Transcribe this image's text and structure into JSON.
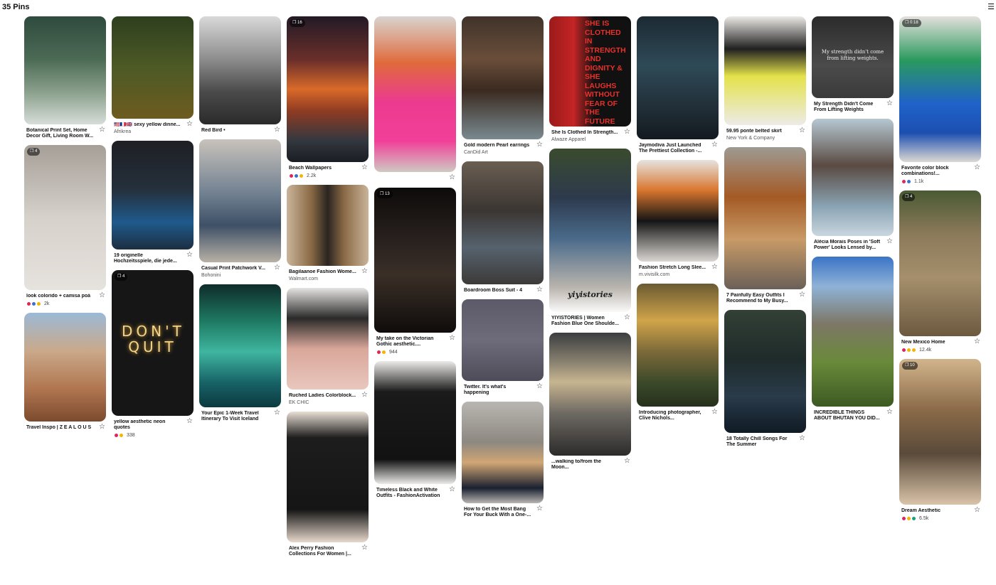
{
  "board": {
    "pin_count_label": "35 Pins"
  },
  "columns": [
    [
      {
        "title": "Botanical Print Set, Home Decor Gift, Living Room W...",
        "source": "",
        "reactions": [],
        "count": "",
        "badge": "",
        "h": 152,
        "bg": "linear-gradient(180deg,#2f4a3e 0%,#4c6b55 40%,#8aa08c 70%,#d7ddd9 100%)"
      },
      {
        "title": "look colorido + camisa poá",
        "source": "",
        "reactions": [
          "#e0245e",
          "#3b6fd8",
          "#f4b400"
        ],
        "count": "2k",
        "badge": "4",
        "h": 204,
        "bg": "linear-gradient(180deg,#a69f98 0%,#d6d1cb 50%,#e6e2dd 100%)"
      },
      {
        "title": "Travel Inspo | Z E A L O U S",
        "source": "",
        "reactions": [],
        "count": "",
        "badge": "",
        "h": 153,
        "bg": "linear-gradient(180deg,#9bb9d6 0%,#caa98a 35%,#b07650 70%,#7b4a2e 100%)"
      }
    ],
    [
      {
        "title": "🇺🇸🇫🇷🇬🇧 sexy yellow dinne...",
        "source": "Afrikrea",
        "reactions": [],
        "count": "",
        "badge": "",
        "h": 144,
        "bg": "linear-gradient(180deg,#2e3f1e 0%,#4d5a26 50%,#6d5b1f 100%)"
      },
      {
        "title": "19 originelle Hochzeitsspiele, die jede...",
        "source": "",
        "reactions": [],
        "count": "",
        "badge": "",
        "h": 153,
        "bg": "linear-gradient(180deg,#1e1f24 0%,#25303c 45%,#1f5a8c 75%,#1c2e40 100%)"
      },
      {
        "title": "yellow aesthetic neon quotes",
        "source": "",
        "reactions": [
          "#e0245e",
          "#f4b400"
        ],
        "count": "338",
        "badge": "4",
        "h": 205,
        "bg": "#161616",
        "overlay": "DON'T QUIT"
      }
    ],
    [
      {
        "title": "Red Bird •",
        "source": "",
        "reactions": [],
        "count": "",
        "badge": "",
        "h": 152,
        "bg": "linear-gradient(180deg,#d9d9d9 0%,#8c8c8c 40%,#4a4a4a 70%,#2a2a2a 100%)"
      },
      {
        "title": "Casual Print Patchwork V...",
        "source": "Bohonini",
        "reactions": [],
        "count": "",
        "badge": "",
        "h": 173,
        "bg": "linear-gradient(180deg,#c8c2bb 0%,#6f7f90 45%,#3e5066 70%,#b8b0a6 100%)"
      },
      {
        "title": "Your Epic 1-Week Travel Itinerary To Visit Iceland",
        "source": "",
        "reactions": [],
        "count": "",
        "badge": "",
        "h": 173,
        "bg": "linear-gradient(180deg,#0f2b2a 0%,#1e7a62 30%,#3fb5a0 55%,#176266 80%,#0c3a40 100%)"
      }
    ],
    [
      {
        "title": "Beach Wallpapers",
        "source": "",
        "reactions": [
          "#e0245e",
          "#3b6fd8",
          "#f4b400"
        ],
        "count": "2.2k",
        "badge": "16",
        "h": 205,
        "bg": "linear-gradient(180deg,#221a26 0%,#6b2f2a 30%,#d96a2a 50%,#8e3b22 65%,#34383f 85%,#1a1d22 100%)"
      },
      {
        "title": "Bagilaanoe Fashion Wome...",
        "source": "Walmart.com",
        "reactions": [],
        "count": "",
        "badge": "",
        "h": 114,
        "bg": "linear-gradient(90deg,#c9b49a 0%,#8a6a45 30%,#2a2420 50%,#8a6a45 70%,#c9b49a 100%)"
      },
      {
        "title": "Ruched Ladies Colorblock...",
        "source": "EK CHIC",
        "reactions": [],
        "count": "",
        "badge": "",
        "h": 143,
        "bg": "linear-gradient(180deg,#e5e4e2 0%,#2a2a2a 30%,#d9a79a 60%,#e9c7bd 100%)"
      },
      {
        "title": "Alex Perry Fashion Collections For Women |...",
        "source": "",
        "reactions": [],
        "count": "",
        "badge": "",
        "h": 184,
        "bg": "linear-gradient(180deg,#e9dfd5 0%,#1d1d1d 20%,#151515 75%,#e7d8cc 100%)"
      }
    ],
    [
      {
        "title": "",
        "source": "",
        "reactions": [],
        "count": "",
        "badge": "",
        "h": 219,
        "bg": "linear-gradient(180deg,#d8d4cf 0%,#e06a3b 30%,#ec3a8f 55%,#f23f99 80%,#cfc9c2 100%)"
      },
      {
        "title": "My take on the Victorian Gothic aesthetic....",
        "source": "",
        "reactions": [
          "#e0245e",
          "#f4b400"
        ],
        "count": "944",
        "badge": "13",
        "h": 204,
        "bg": "linear-gradient(180deg,#0d0b0a 0%,#2b2320 40%,#3a2f27 60%,#0f0c0b 100%)"
      },
      {
        "title": "Timeless Black and White Outfits - FashionActivation",
        "source": "",
        "reactions": [],
        "count": "",
        "badge": "",
        "h": 173,
        "bg": "linear-gradient(180deg,#ecebea 0%,#1a1a1a 25%,#121212 80%,#ecebea 100%)"
      }
    ],
    [
      {
        "title": "Gold modern Pearl earrings",
        "source": "CanDid Art",
        "reactions": [],
        "count": "",
        "badge": "",
        "h": 173,
        "bg": "linear-gradient(180deg,#40332a 0%,#6a4e3a 35%,#3a2a20 60%,#7a8a90 100%)"
      },
      {
        "title": "Boardroom Boss Suit - 4",
        "source": "",
        "reactions": [],
        "count": "",
        "badge": "",
        "h": 173,
        "bg": "linear-gradient(180deg,#6a5e52 0%,#3b3632 40%,#56626e 70%,#3c3a38 100%)"
      },
      {
        "title": "Twitter. It's what's happening",
        "source": "",
        "reactions": [],
        "count": "",
        "badge": "",
        "h": 115,
        "bg": "linear-gradient(180deg,#5c5a68 0%,#6e6c7a 50%,#4e4c59 100%)"
      },
      {
        "title": "How to Get the Most Bang For Your Buck With a One-...",
        "source": "",
        "reactions": [],
        "count": "",
        "badge": "",
        "h": 143,
        "bg": "linear-gradient(180deg,#b9b6b2 0%,#8d8880 40%,#d1a675 60%,#1a2030 85%,#b9b6b2 100%)"
      }
    ],
    [
      {
        "title": "She Is Clothed In Strength...",
        "source": "Alwaze Apparel",
        "reactions": [],
        "count": "",
        "badge": "",
        "h": 155,
        "bg": "linear-gradient(90deg,#9b1b1b 0%,#c42424 30%,#111 55%,#111 100%)",
        "overlay": "SHE IS CLOTHED IN STRENGTH AND DIGNITY & SHE LAUGHS WITHOUT FEAR OF THE FUTURE"
      },
      {
        "title": "YIYISTORIES | Women Fashion Blue One Shoulde...",
        "source": "",
        "reactions": [],
        "count": "",
        "badge": "",
        "h": 230,
        "bg": "linear-gradient(180deg,#3a4b2e 0%,#2d3a4d 30%,#4a6a8a 55%,#b9b4ad 85%,#fafafa 100%)",
        "overlay": "yiyistories"
      },
      {
        "title": "...walking to/from the Moon...",
        "source": "",
        "reactions": [],
        "count": "",
        "badge": "",
        "h": 173,
        "bg": "linear-gradient(180deg,#3b3e40 0%,#8d8472 25%,#c7b590 40%,#6f6a64 65%,#2c2b2a 100%)"
      }
    ],
    [
      {
        "title": "Jaymodiva Just Launched The Prettiest Collection -...",
        "source": "",
        "reactions": [],
        "count": "",
        "badge": "",
        "h": 173,
        "bg": "linear-gradient(180deg,#1c2a33 0%,#2f4a57 40%,#1e2a32 80%,#121a20 100%)"
      },
      {
        "title": "Fashion Stretch Long Slee...",
        "source": "m.vivisilk.com",
        "reactions": [],
        "count": "",
        "badge": "",
        "h": 143,
        "bg": "linear-gradient(180deg,#e6e3df 0%,#d9752e 30%,#151515 60%,#dad7d2 100%)"
      },
      {
        "title": "Introducing photographer, Clive Nichols...",
        "source": "",
        "reactions": [],
        "count": "",
        "badge": "",
        "h": 173,
        "bg": "linear-gradient(180deg,#6a5a32 0%,#d1a44a 30%,#7d6a3a 55%,#3c4a2a 80%,#26301c 100%)"
      }
    ],
    [
      {
        "title": "59.95 ponte belted skirt",
        "source": "New York & Company",
        "reactions": [],
        "count": "",
        "badge": "",
        "h": 153,
        "bg": "linear-gradient(180deg,#eceae6 0%,#202020 30%,#e4e24a 55%,#ecebe7 100%)"
      },
      {
        "title": "7 Painfully Easy Outfits I Recommend to My Busy...",
        "source": "",
        "reactions": [],
        "count": "",
        "badge": "",
        "h": 200,
        "bg": "linear-gradient(180deg,#9e9a92 0%,#a45a25 35%,#c89a66 65%,#6a6058 100%)"
      },
      {
        "title": "18 Totally Chill Songs For The Summer",
        "source": "",
        "reactions": [],
        "count": "",
        "badge": "",
        "h": 173,
        "bg": "linear-gradient(180deg,#324036 0%,#1e2b2a 40%,#2a3b4a 70%,#0f1a24 100%)"
      }
    ],
    [
      {
        "title": "My Strength Didn't Come From Lifting Weights",
        "source": "",
        "reactions": [],
        "count": "",
        "badge": "",
        "h": 115,
        "bg": "linear-gradient(180deg,#2b2b2b 0%,#4b4b4b 60%,#3a3a3a 100%)",
        "overlay": "My strength didn't come from lifting weights."
      },
      {
        "title": "Alécia Morais Poses in 'Soft Power' Looks Lensed by...",
        "source": "",
        "reactions": [],
        "count": "",
        "badge": "",
        "h": 165,
        "bg": "linear-gradient(180deg,#b6c8d2 0%,#5a4a42 40%,#8aa4b4 75%,#c9d6de 100%)"
      },
      {
        "title": "INCREDIBLE THINGS ABOUT BHUTAN YOU DID...",
        "source": "",
        "reactions": [],
        "count": "",
        "badge": "",
        "h": 211,
        "bg": "linear-gradient(180deg,#3b74c6 0%,#8fb2d6 20%,#7d7766 45%,#6a8a3a 70%,#3c5a22 100%)"
      }
    ],
    [
      {
        "title": "Favorite color block combinations!...",
        "source": "",
        "reactions": [
          "#e0245e",
          "#3b6fd8"
        ],
        "count": "1.1k",
        "badge": "0:18",
        "h": 205,
        "bg": "linear-gradient(180deg,#e3e0dc 0%,#2b9a5e 30%,#1f62c9 60%,#1d4fb0 80%,#dcd9d4 100%)"
      },
      {
        "title": "New Mexico Home",
        "source": "",
        "reactions": [
          "#e0245e",
          "#f4b400",
          "#f4b400"
        ],
        "count": "12.4k",
        "badge": "4",
        "h": 205,
        "bg": "linear-gradient(180deg,#4a5a34 0%,#8b7a5a 30%,#a58f6c 60%,#6c5a40 100%)"
      },
      {
        "title": "Dream Aesthetic",
        "source": "",
        "reactions": [
          "#e0245e",
          "#f4b400",
          "#14a37f"
        ],
        "count": "6.5k",
        "badge": "10",
        "h": 205,
        "bg": "linear-gradient(180deg,#d2b48c 0%,#8a6a48 35%,#5a4a3a 65%,#d9c4a8 100%)"
      }
    ]
  ]
}
